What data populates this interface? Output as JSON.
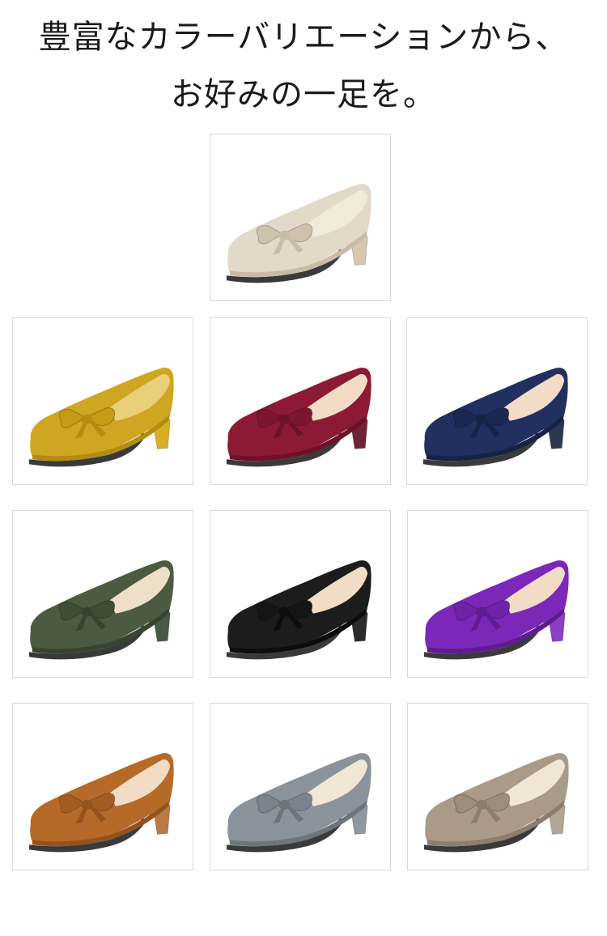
{
  "heading": {
    "line1": "豊富なカラーバリエーションから、",
    "line2": "お好みの一足を。"
  },
  "swatches": [
    {
      "name": "beige-shoe",
      "upper": "#e3d9c9",
      "shade": "#c9bca7",
      "heel": "#d8c7ad",
      "bow": "#cfc2ac",
      "inner": "#f2ead8"
    },
    {
      "name": "mustard-shoe",
      "upper": "#cfa621",
      "shade": "#b38c12",
      "heel": "#d8ae22",
      "bow": "#c69b15",
      "inner": "#e9cf7a"
    },
    {
      "name": "burgundy-shoe",
      "upper": "#8c1a35",
      "shade": "#6f1228",
      "heel": "#6d2436",
      "bow": "#7b1630",
      "inner": "#f2dcc5"
    },
    {
      "name": "navy-shoe",
      "upper": "#21305f",
      "shade": "#162347",
      "heel": "#2c3750",
      "bow": "#1b2852",
      "inner": "#f2dcc5"
    },
    {
      "name": "olive-shoe",
      "upper": "#4b5a40",
      "shade": "#374530",
      "heel": "#4a5a44",
      "bow": "#3e4d36",
      "inner": "#eee0c8"
    },
    {
      "name": "black-shoe",
      "upper": "#1c1c1c",
      "shade": "#0d0d0d",
      "heel": "#2b2b2b",
      "bow": "#151515",
      "inner": "#f2dcc5"
    },
    {
      "name": "purple-shoe",
      "upper": "#7b28b8",
      "shade": "#5f1b92",
      "heel": "#8c3ec4",
      "bow": "#6e22a6",
      "inner": "#f2dcc5"
    },
    {
      "name": "camel-shoe",
      "upper": "#b66a2a",
      "shade": "#94521c",
      "heel": "#b97a45",
      "bow": "#a55c22",
      "inner": "#f2dcc5"
    },
    {
      "name": "grey-shoe",
      "upper": "#8a939c",
      "shade": "#6c747c",
      "heel": "#8e98a2",
      "bow": "#7b848d",
      "inner": "#f2e6d6"
    },
    {
      "name": "taupe-shoe",
      "upper": "#aa9b89",
      "shade": "#8c7e6e",
      "heel": "#b3a593",
      "bow": "#9c8d7c",
      "inner": "#f2e6d6"
    }
  ]
}
